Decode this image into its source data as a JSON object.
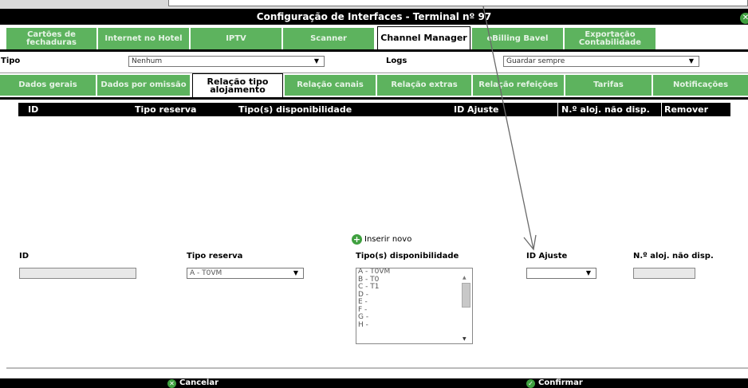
{
  "window": {
    "title": "Configuração de Interfaces - Terminal nº 97"
  },
  "tabs_top": [
    {
      "label": "Cartões de fechaduras"
    },
    {
      "label": "Internet no Hotel"
    },
    {
      "label": "IPTV"
    },
    {
      "label": "Scanner"
    },
    {
      "label": "Channel Manager",
      "active": true
    },
    {
      "label": "eBilling Bavel"
    },
    {
      "label": "Exportação Contabilidade"
    }
  ],
  "form": {
    "tipo_label": "Tipo",
    "tipo_value": "Nenhum",
    "logs_label": "Logs",
    "logs_value": "Guardar sempre"
  },
  "tabs_sub": [
    {
      "label": "Dados gerais"
    },
    {
      "label": "Dados por omissão"
    },
    {
      "label": "Relação tipo alojamento",
      "active": true
    },
    {
      "label": "Relação canais"
    },
    {
      "label": "Relação extras"
    },
    {
      "label": "Relação refeições"
    },
    {
      "label": "Tarifas"
    },
    {
      "label": "Notificações"
    }
  ],
  "table": {
    "headers": [
      "ID",
      "Tipo reserva",
      "Tipo(s) disponibilidade",
      "ID Ajuste",
      "N.º aloj. não disp.",
      "Remover"
    ]
  },
  "insert": {
    "label": "Inserir novo"
  },
  "fields": {
    "id_label": "ID",
    "tipo_reserva_label": "Tipo reserva",
    "tipo_reserva_value": "A - T0VM",
    "disponibilidade_label": "Tipo(s) disponibilidade",
    "disponibilidade_options": [
      "A - T0VM",
      "B - T0",
      "C - T1",
      "D -",
      "E -",
      "F -",
      "G -",
      "H -"
    ],
    "id_ajuste_label": "ID Ajuste",
    "id_ajuste_value": "",
    "naloj_label": "N.º aloj. não disp."
  },
  "footer": {
    "cancel_label": "Cancelar",
    "confirm_label": "Confirmar"
  },
  "icons": {
    "close": "close-icon",
    "add": "plus-icon",
    "cancel": "cancel-icon",
    "confirm": "check-icon",
    "dropdown": "chevron-down-icon"
  },
  "colors": {
    "tab_green": "#5db35e",
    "header_black": "#000000",
    "icon_green": "#3fa03f"
  }
}
